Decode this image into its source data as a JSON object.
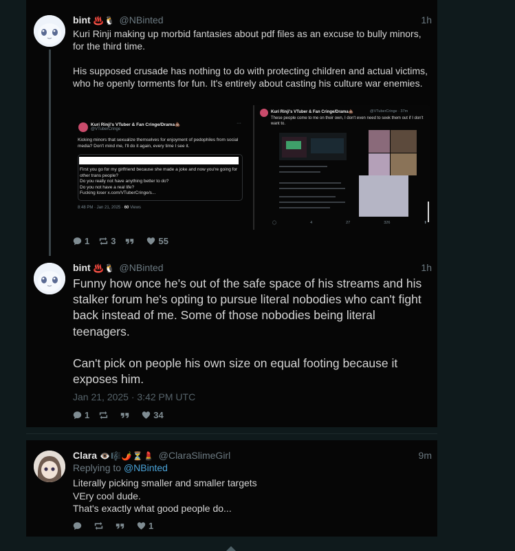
{
  "posts": [
    {
      "name": "bint",
      "emoji": "♨️🐧",
      "handle": "@NBinted",
      "time": "1h",
      "text": "Kuri Rinji making up morbid fantasies about pdf files as an excuse to bully minors, for the third time.\n\nHis supposed crusade has nothing to do with protecting children and actual victims, who he openly torments for fun. It's entirely about casting his culture war enemies.",
      "stats": {
        "replies": "1",
        "reposts": "3",
        "quotes": "",
        "likes": "55"
      },
      "media": {
        "left": {
          "name": "Kuri Rinji's VTuber & Fan Cringe/Drama💩",
          "handle": "@VTuberCringe",
          "text": "Kicking minors that sexualize themselves for enjoyment of pedophiles from social media? Don't mind me, I'll do it again, every time I see it.",
          "quoted": "First you go for my girlfriend because she made a joke and now you're going for other trans people?\nDo you really not have anything better to do?\nDo you not have a real life?\nFucking loser x.com/VTuberCringe/s...",
          "footer_time": "8:48 PM · Jan 21, 2025 · ",
          "footer_views": "60",
          "footer_views_label": " Views"
        },
        "right": {
          "name": "Kuri Rinji's VTuber & Fan Cringe/Drama💩",
          "handle": "@VTuberCringe · 37m",
          "text": "These people come to me on their own, I don't even need to seek them out if I don't want to.",
          "stats": [
            "4",
            "27",
            "326"
          ]
        }
      }
    },
    {
      "name": "bint",
      "emoji": "♨️🐧",
      "handle": "@NBinted",
      "time": "1h",
      "text": "Funny how once he's out of the safe space of his streams and his stalker forum he's opting to pursue literal nobodies who can't fight back instead of me. Some of those nobodies being literal teenagers.\n\nCan't pick on people his own size on equal footing because it exposes him.",
      "date": "Jan 21, 2025 · 3:42 PM UTC",
      "stats": {
        "replies": "1",
        "reposts": "",
        "quotes": "",
        "likes": "34"
      }
    },
    {
      "name": "Clara",
      "emoji": "👁️🎼🌶️⏳💄",
      "handle": "@ClaraSlimeGirl",
      "time": "9m",
      "replying_prefix": "Replying to ",
      "replying_to": "@NBinted",
      "text": "Literally picking smaller and smaller targets\nVEry cool dude.\nThat's exactly what good people do...",
      "stats": {
        "replies": "",
        "reposts": "",
        "quotes": "",
        "likes": "1"
      }
    }
  ],
  "icons": [
    "comment-icon",
    "repost-icon",
    "quote-icon",
    "heart-icon",
    "chevron-up-icon"
  ]
}
